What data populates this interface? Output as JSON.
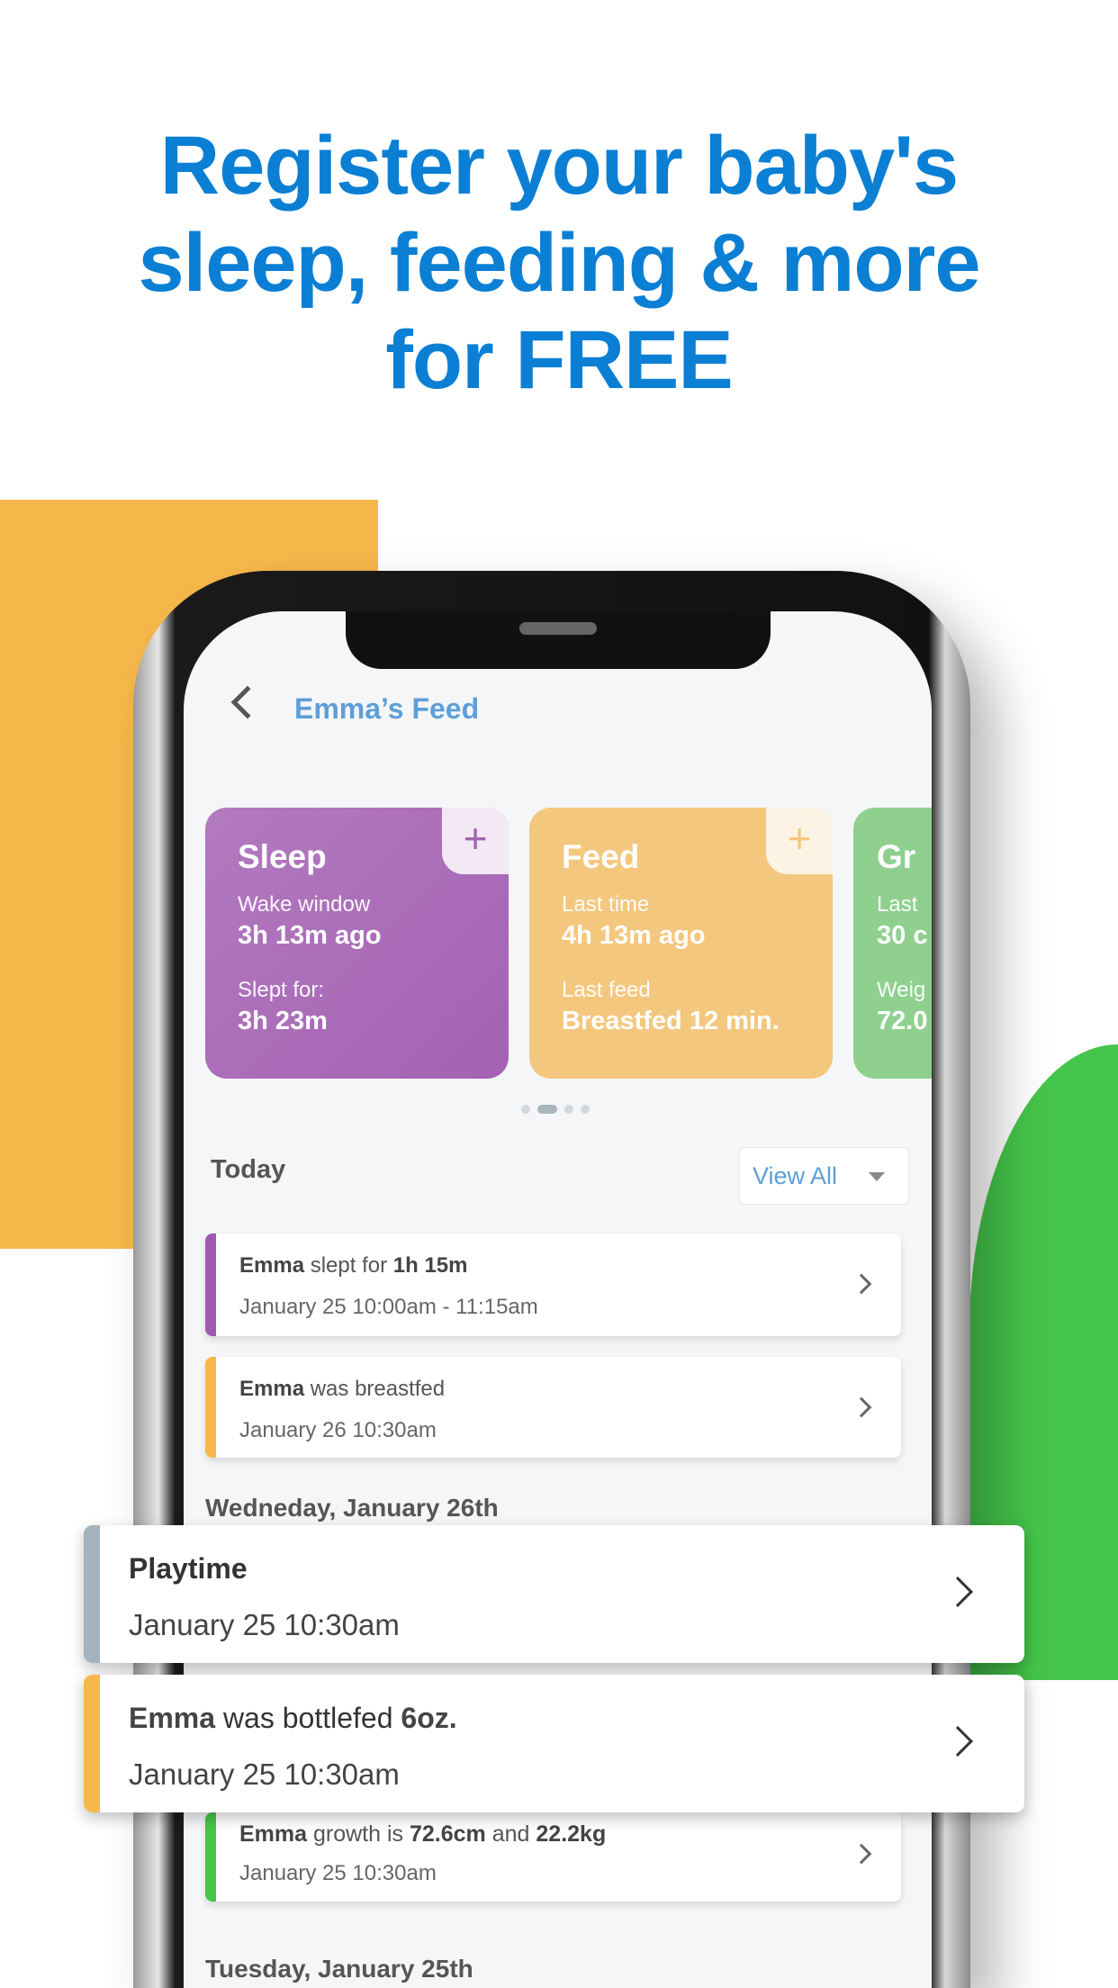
{
  "headline": {
    "line1": "Register your baby's",
    "line2": "sleep, feeding & more",
    "line3": "for FREE"
  },
  "colors": {
    "headline": "#0a7fd4",
    "orange": "#f7b84b",
    "green": "#45c54a",
    "sleep": "#a96bb8",
    "feed": "#f4c77e",
    "growth": "#8fd08f",
    "playtime": "#a3b2bd"
  },
  "header": {
    "back_icon": "chevron-left-icon",
    "title": "Emma’s Feed"
  },
  "cards": [
    {
      "title": "Sleep",
      "label1": "Wake window",
      "value1": "3h 13m ago",
      "label2": "Slept for:",
      "value2": "3h 23m",
      "add_icon": "plus-icon",
      "plus": "+"
    },
    {
      "title": "Feed",
      "label1": "Last time",
      "value1": "4h 13m ago",
      "label2": "Last feed",
      "value2": "Breastfed 12 min.",
      "add_icon": "plus-icon",
      "plus": "+"
    },
    {
      "title": "Gr",
      "label1": "Last",
      "value1": "30 c",
      "label2": "Weig",
      "value2": "72.0"
    }
  ],
  "pager": {
    "pages": 4,
    "active": 1
  },
  "today": {
    "label": "Today",
    "view_all": "View All"
  },
  "items": [
    {
      "name": "Emma",
      "text": " slept for ",
      "bold": "1h 15m",
      "date": "January 25 10:00am - 11:15am"
    },
    {
      "name": "Emma",
      "text": " was breastfed",
      "date": "January 26 10:30am"
    }
  ],
  "day1": "Wedneday, January 26th",
  "floating": [
    {
      "title": "Playtime",
      "date": "January 25 10:30am"
    },
    {
      "name": "Emma",
      "text": " was bottlefed ",
      "bold": "6oz.",
      "date": "January 25 10:30am"
    }
  ],
  "growth_item": {
    "name": "Emma",
    "text1": " growth is ",
    "v1": "72.6cm",
    "text2": " and ",
    "v2": "22.2kg",
    "date": "January 25 10:30am"
  },
  "day2": "Tuesday, January 25th"
}
